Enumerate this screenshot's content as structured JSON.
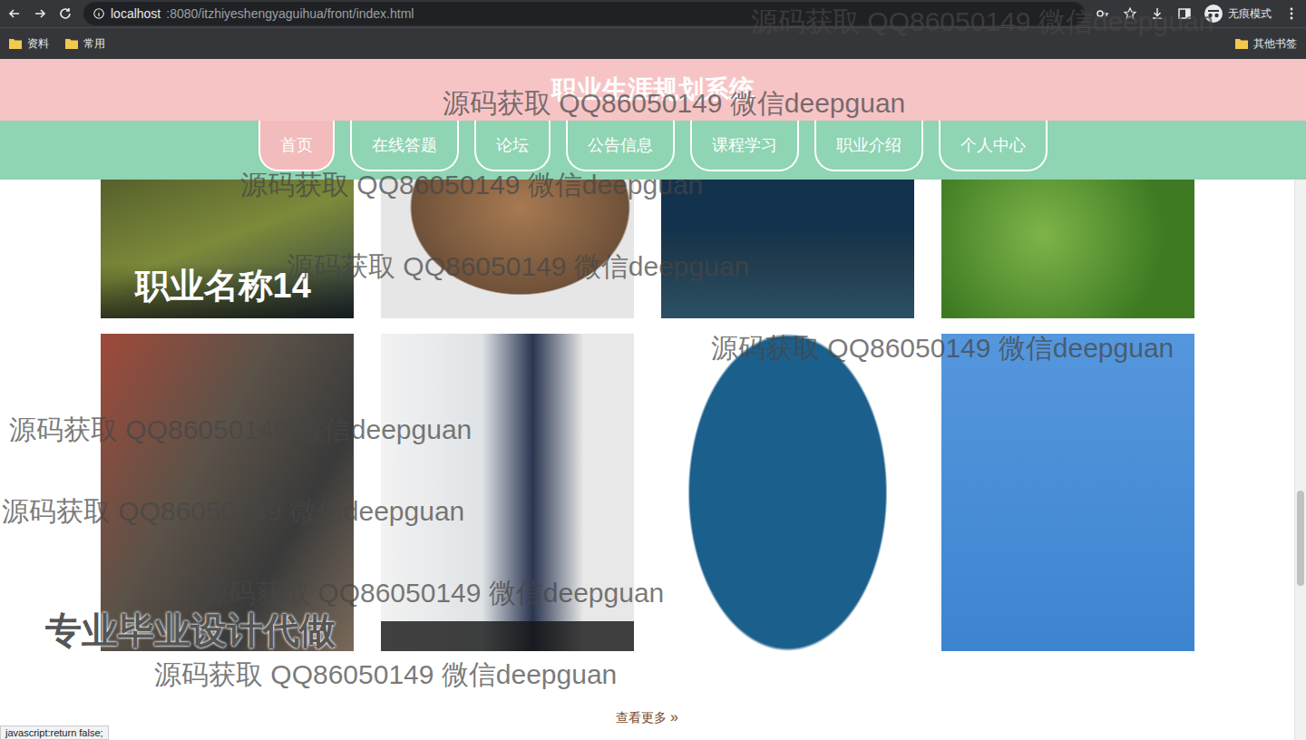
{
  "browser": {
    "url_host": "localhost",
    "url_path": ":8080/itzhiyeshengyaguihua/front/index.html",
    "profile": "无痕模式",
    "bookmarks": [
      {
        "label": "资料"
      },
      {
        "label": "常用"
      }
    ],
    "other_bookmarks": "其他书签",
    "status": "javascript:return false;"
  },
  "site": {
    "title": "职业生涯规划系统"
  },
  "nav": [
    {
      "label": "首页",
      "selected": true
    },
    {
      "label": "在线答题",
      "selected": false
    },
    {
      "label": "论坛",
      "selected": false
    },
    {
      "label": "公告信息",
      "selected": false
    },
    {
      "label": "课程学习",
      "selected": false
    },
    {
      "label": "职业介绍",
      "selected": false
    },
    {
      "label": "个人中心",
      "selected": false
    }
  ],
  "cards": [
    {
      "caption": "职业名称14",
      "overlay": false
    },
    {
      "caption": "",
      "overlay": false
    },
    {
      "caption": "",
      "overlay": false
    },
    {
      "caption": "",
      "overlay": false
    },
    {
      "caption": "",
      "overlay": false
    },
    {
      "caption": "",
      "overlay": true
    },
    {
      "caption": "",
      "overlay": false
    },
    {
      "caption": "",
      "overlay": false
    }
  ],
  "more": {
    "label": "查看更多",
    "icon": "»"
  },
  "watermarks": [
    "源码获取 QQ86050149 微信deepguan",
    "源码获取 QQ86050149 微信deepguan",
    "源码获取 QQ86050149 微信deepguan",
    "源码获取 QQ86050149 微信deepguan",
    "源码获取 QQ86050149 微信deepguan",
    "源码获取 QQ86050149 微信deepguan",
    "源码获取 QQ86050149 微信deepguan",
    "源码获取 QQ86050149 微信deepguan",
    "源码获取 QQ86050149 微信deepguan"
  ],
  "ad": "专业毕业设计代做"
}
